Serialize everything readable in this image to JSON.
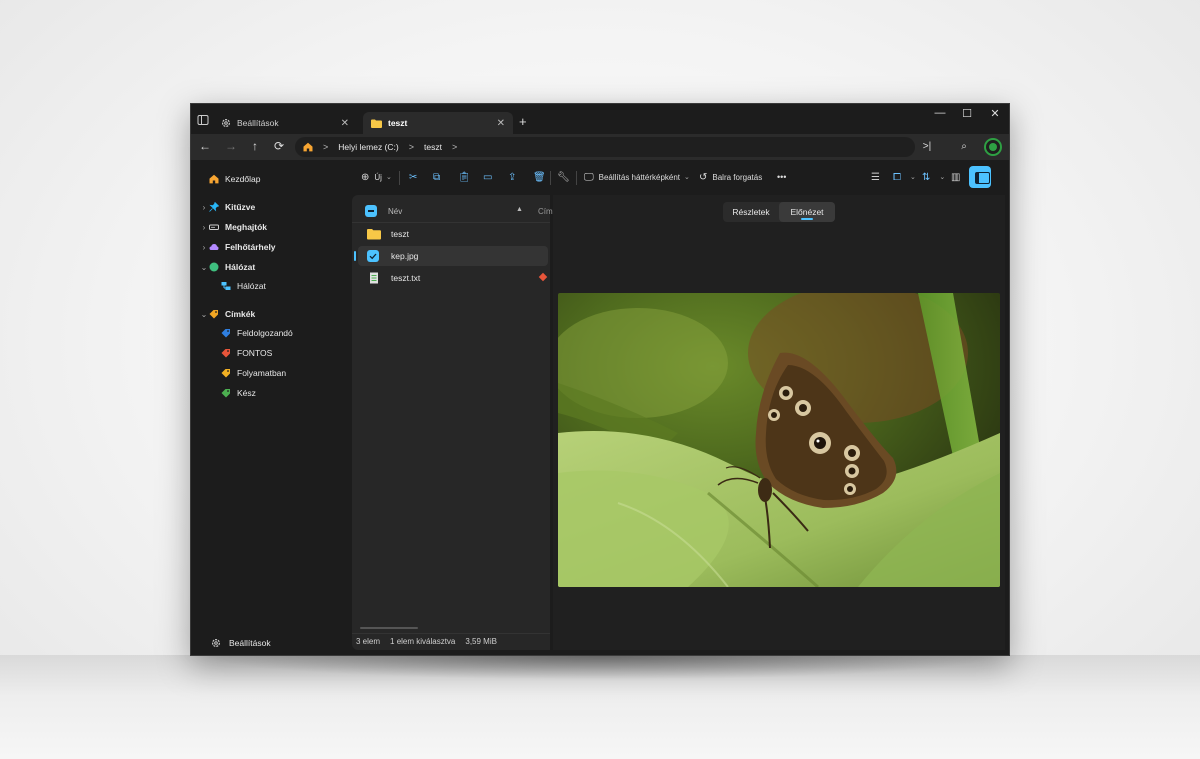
{
  "tabs": [
    {
      "label": "Beállítások",
      "icon": "gear-icon"
    },
    {
      "label": "teszt",
      "icon": "folder-icon",
      "active": true
    }
  ],
  "address": {
    "crumbs": [
      "Helyi lemez (C:)",
      "teszt"
    ]
  },
  "sidebar": {
    "items": [
      {
        "label": "Kezdőlap",
        "icon": "home-icon",
        "color": "#f7a532"
      },
      {
        "label": "Kitűzve",
        "icon": "pin-icon",
        "color": "#29b6f6"
      },
      {
        "label": "Meghajtók",
        "icon": "drive-icon",
        "color": "#d0d0d0"
      },
      {
        "label": "Felhőtárhely",
        "icon": "cloud-icon",
        "color": "#b389ff"
      },
      {
        "label": "Hálózat",
        "icon": "globe-icon",
        "color": "#3fbf7f"
      },
      {
        "label": "Hálózat",
        "icon": "network-icon",
        "color": "#4cc2ff"
      },
      {
        "label": "Címkék",
        "icon": "tag-icon",
        "color": "#f2a623"
      },
      {
        "label": "Feldolgozandó",
        "icon": "tag-icon",
        "color": "#2f7fe0"
      },
      {
        "label": "FONTOS",
        "icon": "tag-icon",
        "color": "#e8553a"
      },
      {
        "label": "Folyamatban",
        "icon": "tag-icon",
        "color": "#f2b023"
      },
      {
        "label": "Kész",
        "icon": "tag-icon",
        "color": "#4caf50"
      }
    ],
    "settings_label": "Beállítások"
  },
  "toolbar": {
    "new_label": "Új",
    "wallpaper_label": "Beállítás háttérképként",
    "rotate_label": "Balra forgatás",
    "more": "•••"
  },
  "filelist": {
    "col_name": "Név",
    "col_tags": "Cím",
    "rows": [
      {
        "name": "teszt",
        "icon": "folder-icon"
      },
      {
        "name": "kep.jpg",
        "icon": "image-icon"
      },
      {
        "name": "teszt.txt",
        "icon": "text-file-icon"
      }
    ]
  },
  "status": {
    "count": "3 elem",
    "selected": "1 elem kiválasztva",
    "size": "3,59 MiB"
  },
  "preview": {
    "tab_details": "Részletek",
    "tab_preview": "Előnézet"
  },
  "accent": "#4cc2ff"
}
